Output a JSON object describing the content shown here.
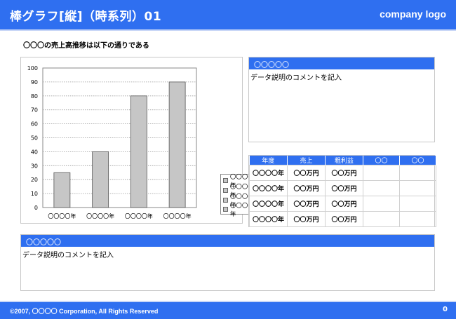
{
  "header": {
    "title": "棒グラフ[縦]（時系列）01",
    "logo": "company logo"
  },
  "subtitle": "〇〇〇の売上高推移は以下の通りである",
  "chart_data": {
    "type": "bar",
    "categories": [
      "〇〇〇〇年",
      "〇〇〇〇年",
      "〇〇〇〇年",
      "〇〇〇〇年"
    ],
    "values": [
      25,
      40,
      80,
      90
    ],
    "ylim": [
      0,
      100
    ],
    "yticks": [
      0,
      10,
      20,
      30,
      40,
      50,
      60,
      70,
      80,
      90,
      100
    ],
    "grid": true,
    "legend_position": "right",
    "legend": [
      "〇〇〇〇年",
      "〇〇〇〇年",
      "〇〇〇〇年",
      "〇〇〇〇年"
    ],
    "bar_color": "#c6c6c6"
  },
  "top_panel": {
    "header": "〇〇〇〇〇",
    "body": "データ説明のコメントを記入"
  },
  "table": {
    "headers": [
      "年度",
      "売上",
      "粗利益",
      "〇〇",
      "〇〇"
    ],
    "rows": [
      [
        "〇〇〇〇年",
        "〇〇万円",
        "〇〇万円",
        "",
        ""
      ],
      [
        "〇〇〇〇年",
        "〇〇万円",
        "〇〇万円",
        "",
        ""
      ],
      [
        "〇〇〇〇年",
        "〇〇万円",
        "〇〇万円",
        "",
        ""
      ],
      [
        "〇〇〇〇年",
        "〇〇万円",
        "〇〇万円",
        "",
        ""
      ]
    ]
  },
  "bottom_panel": {
    "header": "〇〇〇〇〇",
    "body": "データ説明のコメントを記入"
  },
  "footer": {
    "copyright": "©2007, 〇〇〇〇 Corporation, All Rights Reserved",
    "page": "0"
  },
  "colors": {
    "accent": "#2f6ff0",
    "bar": "#c6c6c6"
  }
}
